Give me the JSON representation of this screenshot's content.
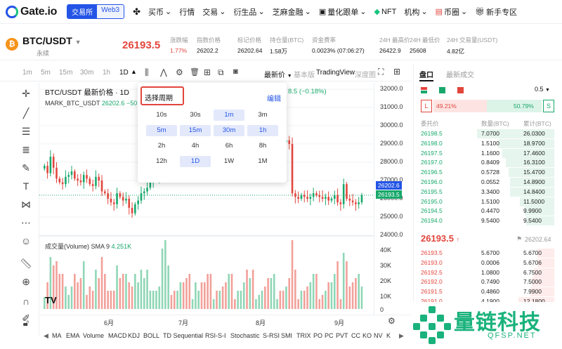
{
  "nav": {
    "logo": "Gate.io",
    "seg_exchange": "交易所",
    "seg_web3": "Web3",
    "items": [
      "买币",
      "行情",
      "交易",
      "衍生品",
      "芝麻金融",
      "量化跟单",
      "NFT",
      "机构",
      "币圈",
      "新手专区"
    ]
  },
  "ticker": {
    "pair": "BTC/USDT",
    "sub": "永续",
    "price": "26193.5",
    "stats": [
      {
        "label": "涨跌幅",
        "value": "1.77%",
        "color": "#e2453c"
      },
      {
        "label": "指数价格",
        "value": "26202.2"
      },
      {
        "label": "标记价格",
        "value": "26202.64"
      },
      {
        "label": "持仓量(BTC)",
        "value": "1.58万"
      },
      {
        "label": "资金费率",
        "value": "0.0023% (07:06:27)"
      },
      {
        "label": "24H 最高价",
        "value": "26422.9"
      },
      {
        "label": "24H 最低价",
        "value": "25608"
      },
      {
        "label": "24H 交易量(USDT)",
        "value": "4.82亿"
      }
    ]
  },
  "toolbar": {
    "intervals": [
      "1m",
      "5m",
      "15m",
      "30m",
      "1h",
      "1D"
    ],
    "latest": "最新价",
    "basic": "基本版",
    "tv": "TradingView",
    "depth": "深度图"
  },
  "chart": {
    "title": "BTC/USDT 最新价格 · 1D",
    "change": "8.5 (−0.18%)",
    "mark_label": "MARK_BTC_USDT",
    "mark_value": "26202.6",
    "mark_change": "−50.",
    "volume_label": "成交量(Volume) SMA 9",
    "volume_value": "4.251K",
    "price_ticks": [
      "32000.0",
      "31000.0",
      "30000.0",
      "29000.0",
      "28000.0",
      "27000.0",
      "26000.0",
      "25000.0",
      "24000.0"
    ],
    "vol_ticks": [
      "40K",
      "30K",
      "20K",
      "10K",
      "0"
    ],
    "tag_mark": "26202.6",
    "tag_last": "26193.5",
    "months": [
      "6月",
      "7月",
      "8月",
      "9月"
    ],
    "candles_close_series": [
      27800,
      27400,
      28300,
      27700,
      27100,
      26900,
      26800,
      27200,
      27300,
      27500,
      27100,
      27000,
      26900,
      27300,
      27100,
      26800,
      26700,
      27200,
      27000,
      26400,
      26300,
      26000,
      25800,
      25700,
      26300,
      26100,
      25900,
      26000,
      25500,
      25200,
      25700,
      25900,
      26300,
      26400,
      26600,
      26900,
      27100,
      27200,
      27300,
      28200,
      29400,
      29700,
      29500,
      29300,
      29400,
      29600,
      29500,
      29400,
      29300,
      29400,
      29800,
      29900,
      29700,
      29600,
      29400,
      29300,
      29400,
      29200,
      29300,
      29200,
      29100,
      29300,
      29200,
      29100,
      29300,
      29400,
      29600,
      29200,
      29300,
      29100,
      29200,
      29300,
      29400,
      29300,
      29100,
      29200,
      29300,
      29400,
      29200,
      29100,
      29200,
      29000,
      26300,
      26100,
      26000,
      26200,
      26100,
      26000,
      26100,
      26300,
      26200,
      26100,
      26000,
      26100,
      25900,
      26000,
      26200,
      25800,
      25700,
      26800,
      26000,
      25900,
      25800,
      25700,
      25800,
      26200
    ]
  },
  "indicators": [
    "MA",
    "EMA",
    "Volume",
    "MACD",
    "KDJ",
    "BOLL",
    "TD Sequential",
    "RSI-S-I",
    "Stochastic",
    "S-RSI",
    "SMI",
    "TRIX",
    "PO",
    "PC",
    "PVT",
    "CC",
    "KO",
    "NV",
    "K"
  ],
  "period_popup": {
    "title": "选择周期",
    "edit": "编辑",
    "rows": [
      [
        {
          "l": "10s",
          "s": false
        },
        {
          "l": "30s",
          "s": false
        },
        {
          "l": "1m",
          "s": true
        },
        {
          "l": "3m",
          "s": false
        }
      ],
      [
        {
          "l": "5m",
          "s": true
        },
        {
          "l": "15m",
          "s": true
        },
        {
          "l": "30m",
          "s": true
        },
        {
          "l": "1h",
          "s": true
        }
      ],
      [
        {
          "l": "2h",
          "s": false
        },
        {
          "l": "4h",
          "s": false
        },
        {
          "l": "6h",
          "s": false
        },
        {
          "l": "8h",
          "s": false
        }
      ],
      [
        {
          "l": "12h",
          "s": false
        },
        {
          "l": "1D",
          "s": true
        },
        {
          "l": "1W",
          "s": false
        },
        {
          "l": "1M",
          "s": false
        }
      ]
    ]
  },
  "book": {
    "tab_book": "盘口",
    "tab_trades": "最新成交",
    "precision": "0.5",
    "long_label": "L",
    "long_pct": "49.21%",
    "short_pct": "50.79%",
    "short_label": "S",
    "col_price": "委托价",
    "col_qty": "数量(BTC)",
    "col_total": "累计(BTC)",
    "asks": [
      [
        "26198.5",
        "7.0700",
        "26.0300"
      ],
      [
        "26198.0",
        "1.5100",
        "18.9700"
      ],
      [
        "26197.5",
        "1.1600",
        "17.4600"
      ],
      [
        "26197.0",
        "0.8409",
        "16.3100"
      ],
      [
        "26196.5",
        "0.5728",
        "15.4700"
      ],
      [
        "26196.0",
        "0.0552",
        "14.8900"
      ],
      [
        "26195.5",
        "3.3400",
        "14.8400"
      ],
      [
        "26195.0",
        "1.5100",
        "11.5000"
      ],
      [
        "26194.5",
        "0.4470",
        "9.9900"
      ],
      [
        "26194.0",
        "9.5400",
        "9.5400"
      ]
    ],
    "mid_price": "26193.5",
    "mid_mark": "26202.64",
    "bids": [
      [
        "26193.5",
        "5.6700",
        "5.6700"
      ],
      [
        "26193.0",
        "0.0006",
        "5.6706"
      ],
      [
        "26192.5",
        "1.0800",
        "6.7500"
      ],
      [
        "26192.0",
        "0.7490",
        "7.5000"
      ],
      [
        "26191.5",
        "0.4860",
        "7.9900"
      ],
      [
        "26191.0",
        "4.1900",
        "12.1800"
      ]
    ],
    "colors": {
      "up": "#17a86b",
      "down": "#e2453c",
      "accent": "#2354e6"
    }
  },
  "watermark": {
    "brand": "量链科技",
    "url": "QFSP.NET"
  }
}
